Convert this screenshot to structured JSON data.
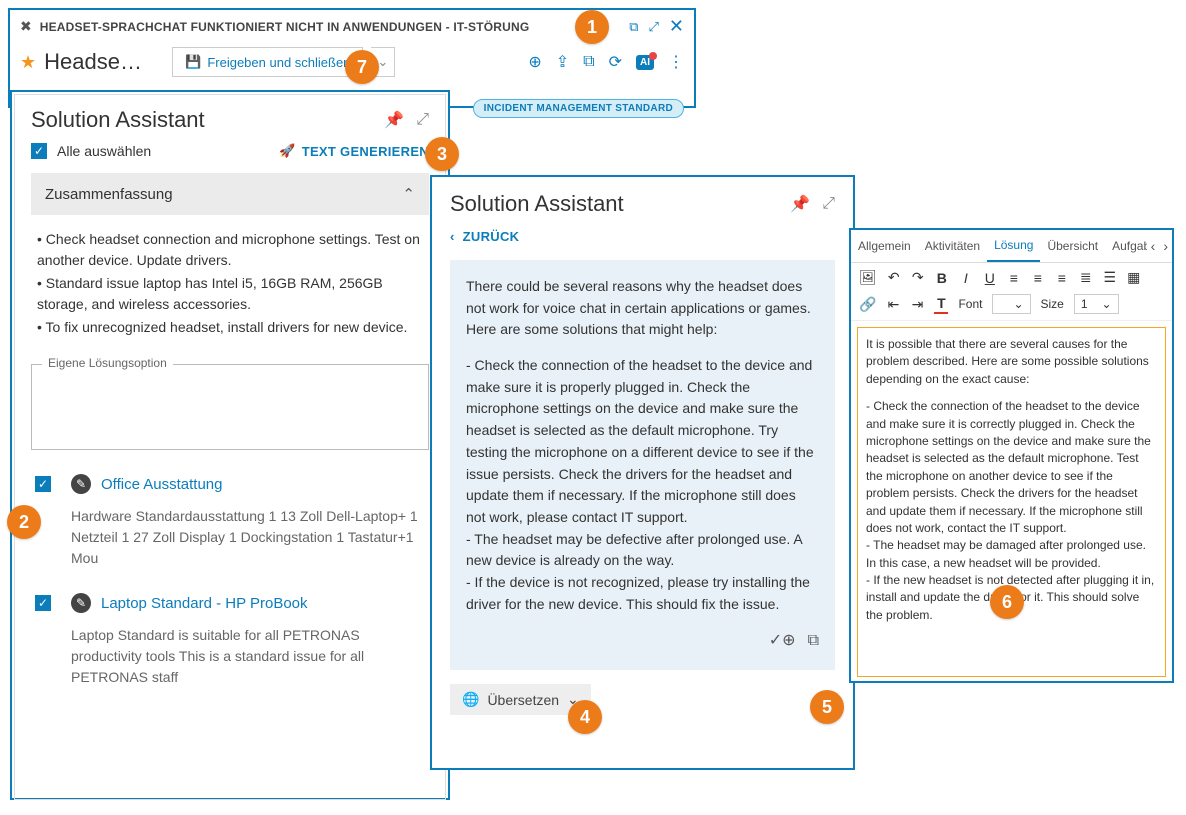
{
  "window": {
    "title": "HEADSET-SPRACHCHAT FUNKTIONIERT NICHT IN ANWENDUNGEN - IT-STÖRUNG",
    "heading_truncated": "Headse…",
    "save_close_label": "Freigeben und schließen",
    "pill_label": "INCIDENT MANAGEMENT STANDARD"
  },
  "assistant_left": {
    "title": "Solution Assistant",
    "select_all_label": "Alle auswählen",
    "generate_label": "TEXT GENERIEREN",
    "summary_header": "Zusammenfassung",
    "summary_lines": [
      "• Check headset connection and microphone settings. Test on another device. Update drivers.",
      "• Standard issue laptop has Intel i5, 16GB RAM, 256GB storage, and wireless accessories.",
      "• To fix unrecognized headset, install drivers for new device."
    ],
    "own_solution_label": "Eigene Lösungsoption",
    "kb_items": [
      {
        "title": "Office Ausstattung",
        "desc": "Hardware Standardausstattung 1 13 Zoll Dell-Laptop+ 1 Netzteil 1 27 Zoll Display 1 Dockingstation 1 Tastatur+1 Mou"
      },
      {
        "title": "Laptop Standard - HP ProBook",
        "desc": "Laptop Standard is suitable for all PETRONAS productivity tools This is a standard issue for all PETRONAS staff"
      }
    ]
  },
  "assistant_right": {
    "title": "Solution Assistant",
    "back_label": "ZURÜCK",
    "generated_intro": "There could be several reasons why the headset does not work for voice chat in certain applications or games. Here are some solutions that might help:",
    "generated_body": "- Check the connection of the headset to the device and make sure it is properly plugged in. Check the microphone settings on the device and make sure the headset is selected as the default microphone. Try testing the microphone on a different device to see if the issue persists. Check the drivers for the headset and update them if necessary. If the microphone still does not work, please contact IT support.\n- The headset may be defective after prolonged use. A new device is already on the way.\n- If the device is not recognized, please try installing the driver for the new device. This should fix the issue.",
    "translate_label": "Übersetzen"
  },
  "editor": {
    "tabs": [
      "Allgemein",
      "Aktivitäten",
      "Lösung",
      "Übersicht",
      "Aufgabe"
    ],
    "active_tab_index": 2,
    "font_label": "Font",
    "size_label": "Size",
    "size_value": "1",
    "body_intro": "It is possible that there are several causes for the problem described. Here are some possible solutions depending on the exact cause:",
    "body_rest": "- Check the connection of the headset to the device and make sure it is correctly plugged in. Check the microphone settings on the device and make sure the headset is selected as the default microphone. Test the microphone on another device to see if the problem persists. Check the drivers for the headset and update them if necessary. If the microphone still does not work, contact the IT support.\n- The headset may be damaged after prolonged use. In this case, a new headset will be provided.\n- If the new headset is not detected after plugging it in, install and update the driver for it. This should solve the problem."
  },
  "badges": [
    "1",
    "2",
    "3",
    "4",
    "5",
    "6",
    "7"
  ]
}
